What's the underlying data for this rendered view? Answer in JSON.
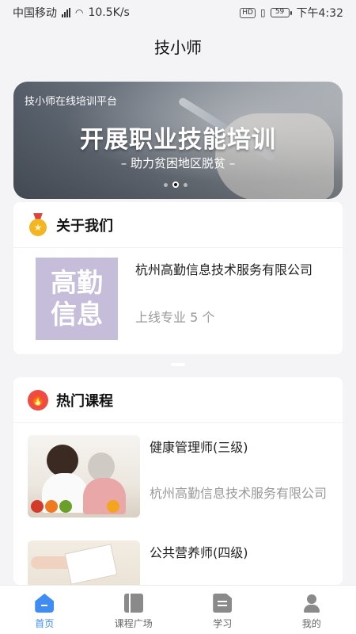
{
  "status_bar": {
    "carrier": "中国移动",
    "network_speed": "10.5K/s",
    "battery": "59",
    "time": "下午4:32",
    "hd": "HD"
  },
  "header": {
    "title": "技小师"
  },
  "banner": {
    "tag": "技小师在线培训平台",
    "headline": "开展职业技能培训",
    "subline": "– 助力贫困地区脱贫 –",
    "slide_count": 3,
    "active_slide": 2
  },
  "about": {
    "title": "关于我们",
    "logo_line1": "高勤",
    "logo_line2": "信息",
    "company": "杭州高勤信息技术服务有限公司",
    "online_majors": "上线专业 5 个"
  },
  "hot_courses": {
    "title": "热门课程",
    "items": [
      {
        "name": "健康管理师(三级)",
        "provider": "杭州高勤信息技术服务有限公司"
      },
      {
        "name": "公共营养师(四级)",
        "provider": ""
      }
    ]
  },
  "tab_bar": {
    "tabs": [
      {
        "label": "首页",
        "icon": "home-icon",
        "active": true
      },
      {
        "label": "课程广场",
        "icon": "book-icon",
        "active": false
      },
      {
        "label": "学习",
        "icon": "document-icon",
        "active": false
      },
      {
        "label": "我的",
        "icon": "user-icon",
        "active": false
      }
    ]
  },
  "colors": {
    "accent": "#3f8cf4",
    "fire": "#ef4b43",
    "medal": "#f3b521",
    "logo_bg": "#c6bddb"
  }
}
